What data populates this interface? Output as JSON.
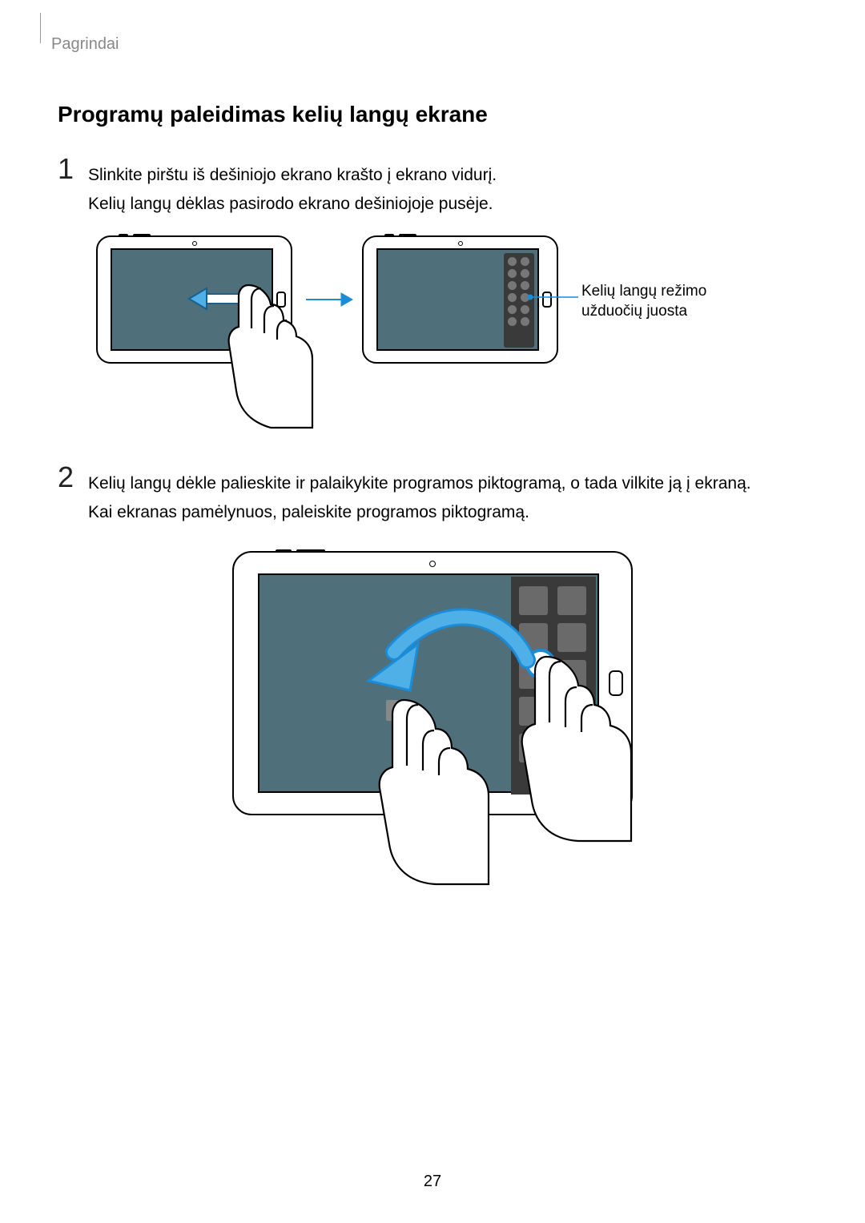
{
  "header": {
    "section": "Pagrindai"
  },
  "title": "Programų paleidimas kelių langų ekrane",
  "steps": {
    "s1": {
      "num": "1",
      "line1": "Slinkite pirštu iš dešiniojo ekrano krašto į ekrano vidurį.",
      "line2": "Kelių langų dėklas pasirodo ekrano dešiniojoje pusėje."
    },
    "s2": {
      "num": "2",
      "line1": "Kelių langų dėkle palieskite ir palaikykite programos piktogramą, o tada vilkite ją į ekraną.",
      "line2": "Kai ekranas pamėlynuos, paleiskite programos piktogramą."
    }
  },
  "callout": {
    "line1": "Kelių langų režimo",
    "line2": "užduočių juosta"
  },
  "pageNumber": "27"
}
